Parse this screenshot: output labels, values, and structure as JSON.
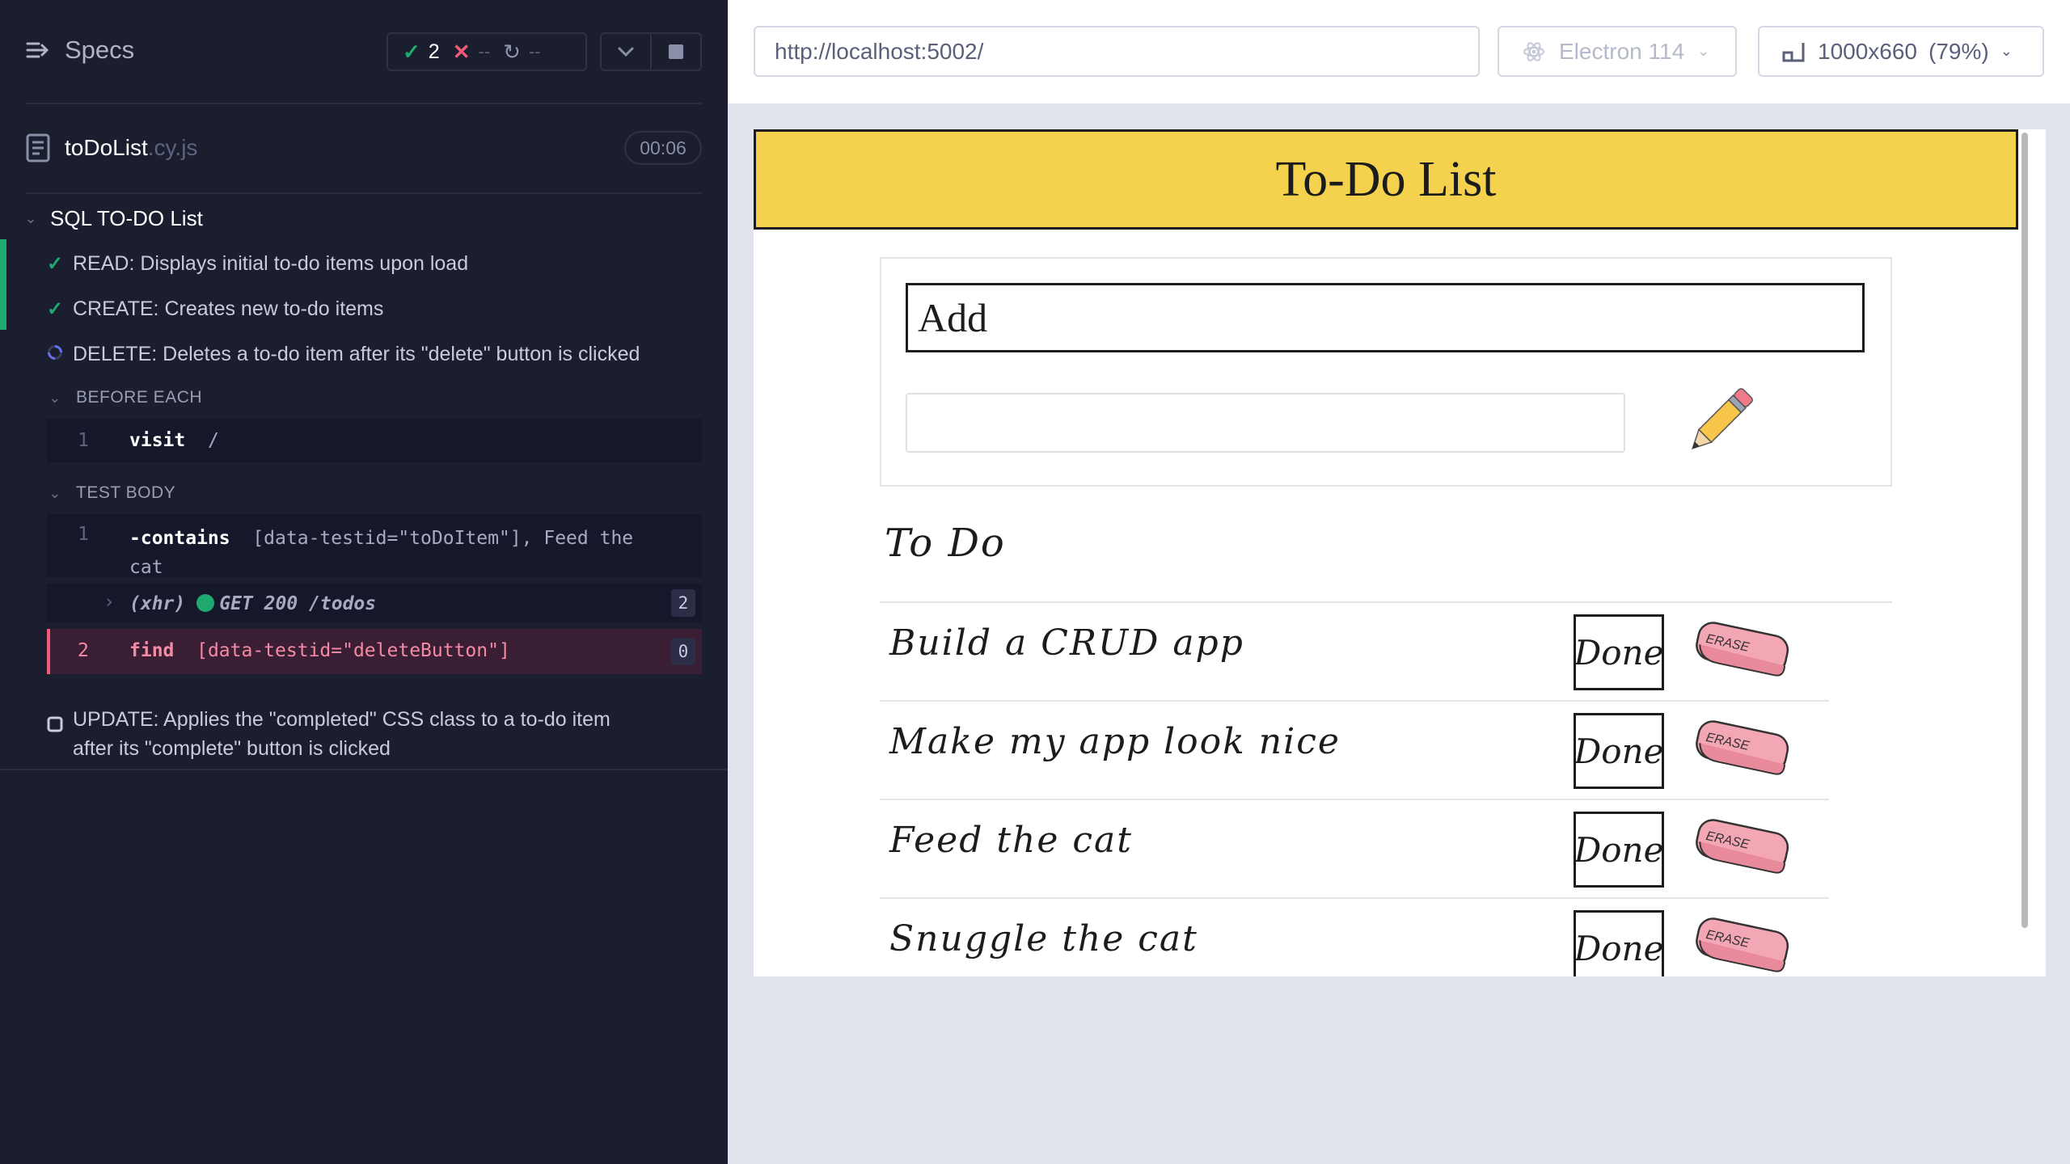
{
  "reporter": {
    "specs_label": "Specs",
    "stats": {
      "passed": "2",
      "failed": "--",
      "pending": "--"
    },
    "file": {
      "name": "toDoList",
      "ext": ".cy.js",
      "duration": "00:06"
    },
    "suite": "SQL TO-DO List",
    "tests": [
      {
        "label": "READ: Displays initial to-do items upon load",
        "state": "passed"
      },
      {
        "label": "CREATE: Creates new to-do items",
        "state": "passed"
      },
      {
        "label": "DELETE: Deletes a to-do item after its \"delete\" button is clicked",
        "state": "running"
      },
      {
        "label": "UPDATE: Applies the \"completed\" CSS class to a to-do item",
        "label2": "after its \"complete\" button is clicked",
        "state": "pending"
      }
    ],
    "before_each": {
      "label": "BEFORE EACH",
      "commands": [
        {
          "num": "1",
          "name": "visit",
          "message": "/"
        }
      ]
    },
    "test_body": {
      "label": "TEST BODY",
      "commands": [
        {
          "num": "1",
          "name": "-contains",
          "message": "[data-testid=\"toDoItem\"], Feed the",
          "message2": "cat"
        },
        {
          "xhr_prefix": "(xhr)",
          "xhr_text": "GET 200 /todos",
          "count": "2"
        },
        {
          "num": "2",
          "name": "find",
          "message": "[data-testid=\"deleteButton\"]",
          "count": "0"
        }
      ]
    }
  },
  "browser": {
    "url": "http://localhost:5002/",
    "name": "Electron 114",
    "viewport": "1000x660",
    "zoom": "(79%)"
  },
  "app": {
    "title": "To-Do List",
    "add_title": "Add",
    "add_input_value": "",
    "todo_heading": "To Do",
    "done_label": "Done",
    "erase_label": "ERASE",
    "todos": [
      "Build a CRUD app",
      "Make my app look nice",
      "Feed the cat",
      "Snuggle the cat"
    ]
  },
  "colors": {
    "reporter_bg": "#1b1e2e",
    "pass": "#1fa971",
    "fail": "#f25a7a",
    "header_yellow": "#f5d24d",
    "eraser_pink": "#f3a6b4"
  }
}
